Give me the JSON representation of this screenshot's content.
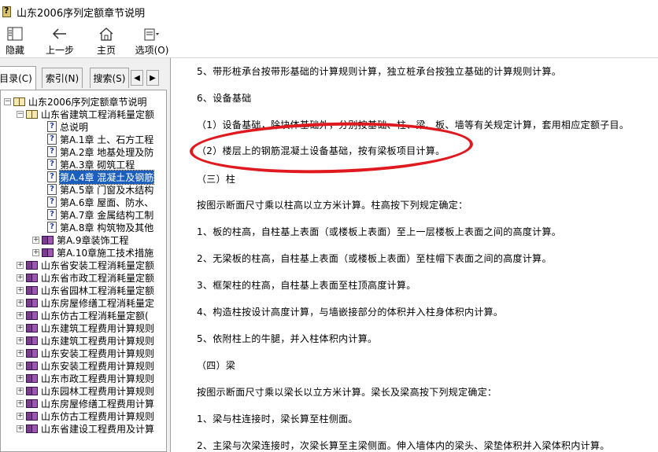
{
  "window": {
    "title": "山东2006序列定额章节说明"
  },
  "toolbar": {
    "buttons": [
      {
        "id": "hide",
        "label": "隐藏",
        "icon": "hide-pane-icon"
      },
      {
        "id": "back",
        "label": "上一步",
        "icon": "back-arrow-icon"
      },
      {
        "id": "home",
        "label": "主页",
        "icon": "home-icon"
      },
      {
        "id": "options",
        "label": "选项(O)",
        "icon": "options-icon"
      }
    ]
  },
  "nav_tabs": [
    {
      "label": "目录(C)",
      "active": true
    },
    {
      "label": "索引(N)",
      "active": false
    },
    {
      "label": "搜索(S)",
      "active": false
    }
  ],
  "tree": {
    "root": "山东2006序列定额章节说明",
    "open_book": "山东省建筑工程消耗量定额",
    "pages": [
      "总说明",
      "第A.1章 土、石方工程",
      "第A.2章 地基处理及防",
      "第A.3章 砌筑工程",
      "第A.4章 混凝土及钢筋",
      "第A.5章 门窗及木结构",
      "第A.6章 屋面、防水、",
      "第A.7章 金属结构工制",
      "第A.8章 构筑物及其他"
    ],
    "selected_page": "第A.4章 混凝土及钢筋",
    "sub_books": [
      "第A.9章装饰工程",
      "第A.10章施工技术措施"
    ],
    "books": [
      "山东省安装工程消耗量定额",
      "山东省市政工程消耗量定额",
      "山东省园林工程消耗量定额",
      "山东房屋修缮工程消耗量定",
      "山东仿古工程消耗量定额(",
      "山东建筑工程费用计算规则",
      "山东建筑工程费用计算规则",
      "山东安装工程费用计算规则",
      "山东安装工程费用计算规则",
      "山东市政工程费用计算规则",
      "山东园林工程费用计算规则",
      "山东房屋修缮工程费用计算",
      "山东仿古工程费用计算规则",
      "山东省建设工程费用及计算"
    ]
  },
  "content": {
    "paragraphs": [
      "5、带形桩承台按带形基础的计算规则计算，独立桩承台按独立基础的计算规则计算。",
      "6、设备基础",
      "（1）设备基础，除块体基础外，分别按基础、柱、梁、板、墙等有关规定计算，套用相应定额子目。",
      "（2）楼层上的钢筋混凝土设备基础，按有梁板项目计算。",
      "（三）柱",
      "按图示断面尺寸乘以柱高以立方米计算。柱高按下列规定确定：",
      "1、板的柱高，自柱基上表面（或楼板上表面）至上一层楼板上表面之间的高度计算。",
      "2、无梁板的柱高，自柱基上表面（或楼板上表面）至柱帽下表面之间的高度计算。",
      "3、框架柱的柱高，自柱基上表面至柱顶高度计算。",
      "4、构造柱按设计高度计算，与墙嵌接部分的体积并入柱身体积内计算。",
      "5、依附柱上的牛腿，并入柱体积内计算。",
      "（四）梁",
      "按图示断面尺寸乘以梁长以立方米计算。梁长及梁高按下列规定确定：",
      "1、梁与柱连接时，梁长算至柱侧面。",
      "2、主梁与次梁连接时，次梁长算至主梁侧面。伸入墙体内的梁头、梁垫体积并入梁体积内计算。"
    ],
    "highlight_color": "#e0191f"
  }
}
